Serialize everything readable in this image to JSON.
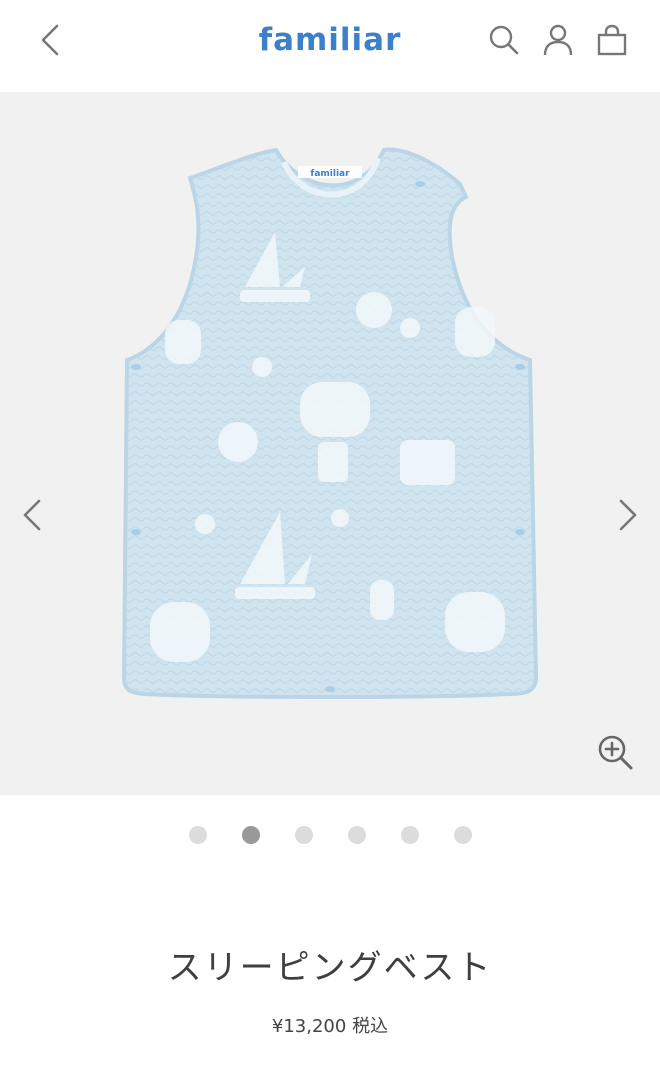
{
  "header": {
    "logo_text": "familiar",
    "logo_color": "#3b80c8"
  },
  "icons": {
    "back": "chevron-left-icon",
    "search": "search-icon",
    "account": "user-icon",
    "cart": "shopping-bag-icon",
    "prev": "chevron-left-icon",
    "next": "chevron-right-icon",
    "zoom": "zoom-in-icon"
  },
  "gallery": {
    "background": "#f1f1f1",
    "garment_color": "#cfe4ef",
    "garment_label_text": "familiar",
    "image_count": 6,
    "active_index": 1
  },
  "product": {
    "name": "スリーピングベスト",
    "price": "¥13,200",
    "tax_label": "税込"
  }
}
